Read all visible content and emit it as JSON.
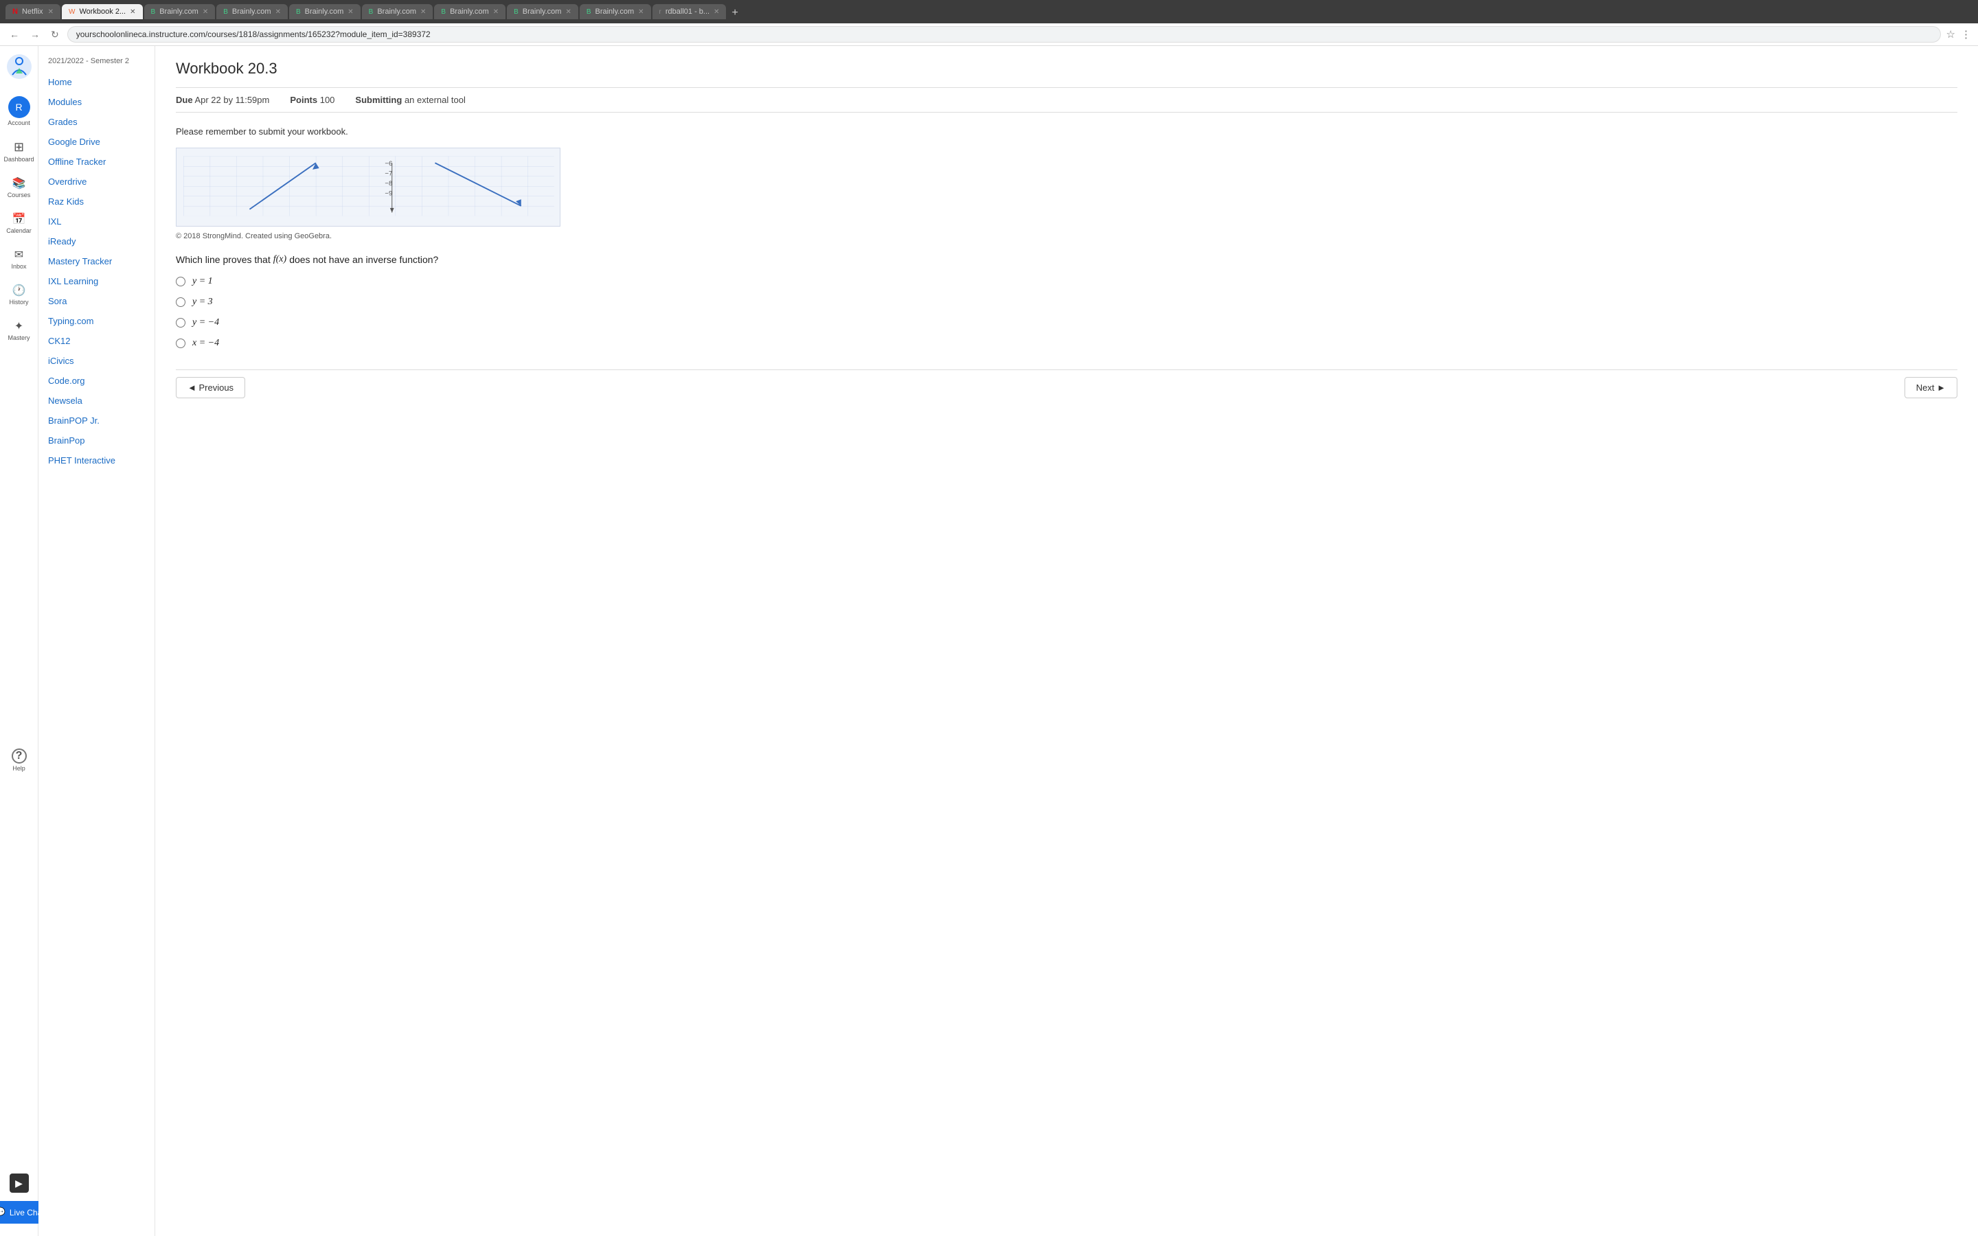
{
  "browser": {
    "tabs": [
      {
        "label": "Netflix",
        "favicon": "N",
        "active": false
      },
      {
        "label": "Workbook 2...",
        "favicon": "W",
        "active": true
      },
      {
        "label": "Brainly.com",
        "favicon": "B",
        "active": false
      },
      {
        "label": "Brainly.com",
        "favicon": "B",
        "active": false
      },
      {
        "label": "Brainly.com",
        "favicon": "B",
        "active": false
      },
      {
        "label": "Brainly.com",
        "favicon": "B",
        "active": false
      },
      {
        "label": "Brainly.com",
        "favicon": "B",
        "active": false
      },
      {
        "label": "Brainly.com",
        "favicon": "B",
        "active": false
      },
      {
        "label": "Brainly.com",
        "favicon": "B",
        "active": false
      },
      {
        "label": "rdball01 - b...",
        "favicon": "r",
        "active": false
      }
    ],
    "url": "yourschoolonlineca.instructure.com/courses/1818/assignments/165232?module_item_id=389372"
  },
  "sidebar": {
    "semester": "2021/2022 - Semester 2",
    "links": [
      "Home",
      "Modules",
      "Grades",
      "Google Drive",
      "Offline Tracker",
      "Overdrive",
      "Raz Kids",
      "IXL",
      "iReady",
      "Mastery Tracker",
      "IXL Learning",
      "Sora",
      "Typing.com",
      "CK12",
      "iCivics",
      "Code.org",
      "Newsela",
      "BrainPOP Jr.",
      "BrainPop",
      "PHET Interactive"
    ]
  },
  "rail": {
    "items": [
      {
        "label": "Account",
        "icon": "👤"
      },
      {
        "label": "Dashboard",
        "icon": "⊞"
      },
      {
        "label": "Courses",
        "icon": "📚"
      },
      {
        "label": "Calendar",
        "icon": "📅"
      },
      {
        "label": "Inbox",
        "icon": "✉️"
      },
      {
        "label": "History",
        "icon": "🕐"
      },
      {
        "label": "Mastery",
        "icon": "✦"
      },
      {
        "label": "Help",
        "icon": "?"
      }
    ]
  },
  "page": {
    "title": "Workbook 20.3",
    "due_label": "Due",
    "due_value": "Apr 22 by 11:59pm",
    "points_label": "Points",
    "points_value": "100",
    "submitting_label": "Submitting",
    "submitting_value": "an external tool",
    "instructions": "Please remember to submit your workbook.",
    "graph_attribution": "© 2018 StrongMind. Created using GeoGebra.",
    "question": "Which line proves that",
    "function_notation": "f(x)",
    "question_suffix": "does not have an inverse function?",
    "options": [
      {
        "id": "opt1",
        "math": "y = 1"
      },
      {
        "id": "opt2",
        "math": "y = 3"
      },
      {
        "id": "opt3",
        "math": "y = −4"
      },
      {
        "id": "opt4",
        "math": "x = −4"
      }
    ],
    "prev_btn": "◄ Previous",
    "next_btn": "Next ►",
    "live_chat": "Live Chat"
  }
}
